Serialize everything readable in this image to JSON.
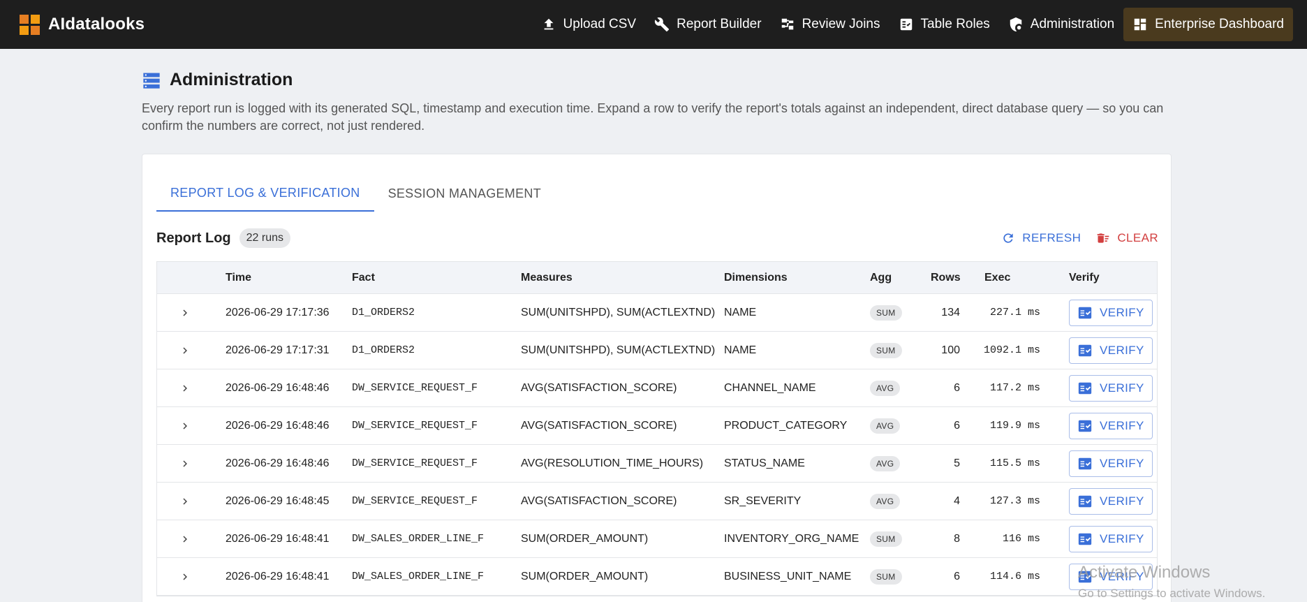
{
  "app": {
    "name": "AIdatalooks"
  },
  "nav": [
    {
      "label": "Upload CSV",
      "icon": "upload-icon"
    },
    {
      "label": "Report Builder",
      "icon": "wrench-icon"
    },
    {
      "label": "Review Joins",
      "icon": "joins-icon"
    },
    {
      "label": "Table Roles",
      "icon": "checklist-icon"
    },
    {
      "label": "Administration",
      "icon": "admin-shield-icon"
    },
    {
      "label": "Enterprise Dashboard",
      "icon": "dashboard-icon",
      "active": true
    }
  ],
  "page": {
    "title": "Administration",
    "description": "Every report run is logged with its generated SQL, timestamp and execution time. Expand a row to verify the report's totals against an independent, direct database query — so you can confirm the numbers are correct, not just rendered."
  },
  "tabs": [
    {
      "label": "REPORT LOG & VERIFICATION",
      "active": true
    },
    {
      "label": "SESSION MANAGEMENT",
      "active": false
    }
  ],
  "report_log": {
    "title": "Report Log",
    "runs_badge": "22 runs",
    "refresh_label": "REFRESH",
    "clear_label": "CLEAR",
    "columns": {
      "time": "Time",
      "fact": "Fact",
      "measures": "Measures",
      "dimensions": "Dimensions",
      "agg": "Agg",
      "rows": "Rows",
      "exec": "Exec",
      "verify": "Verify"
    },
    "verify_label": "VERIFY",
    "rows": [
      {
        "time": "2026-06-29 17:17:36",
        "fact": "D1_ORDERS2",
        "measures": "SUM(UNITSHPD), SUM(ACTLEXTND)",
        "dimensions": "NAME",
        "agg": "SUM",
        "rows": "134",
        "exec": "227.1 ms"
      },
      {
        "time": "2026-06-29 17:17:31",
        "fact": "D1_ORDERS2",
        "measures": "SUM(UNITSHPD), SUM(ACTLEXTND)",
        "dimensions": "NAME",
        "agg": "SUM",
        "rows": "100",
        "exec": "1092.1 ms"
      },
      {
        "time": "2026-06-29 16:48:46",
        "fact": "DW_SERVICE_REQUEST_F",
        "measures": "AVG(SATISFACTION_SCORE)",
        "dimensions": "CHANNEL_NAME",
        "agg": "AVG",
        "rows": "6",
        "exec": "117.2 ms"
      },
      {
        "time": "2026-06-29 16:48:46",
        "fact": "DW_SERVICE_REQUEST_F",
        "measures": "AVG(SATISFACTION_SCORE)",
        "dimensions": "PRODUCT_CATEGORY",
        "agg": "AVG",
        "rows": "6",
        "exec": "119.9 ms"
      },
      {
        "time": "2026-06-29 16:48:46",
        "fact": "DW_SERVICE_REQUEST_F",
        "measures": "AVG(RESOLUTION_TIME_HOURS)",
        "dimensions": "STATUS_NAME",
        "agg": "AVG",
        "rows": "5",
        "exec": "115.5 ms"
      },
      {
        "time": "2026-06-29 16:48:45",
        "fact": "DW_SERVICE_REQUEST_F",
        "measures": "AVG(SATISFACTION_SCORE)",
        "dimensions": "SR_SEVERITY",
        "agg": "AVG",
        "rows": "4",
        "exec": "127.3 ms"
      },
      {
        "time": "2026-06-29 16:48:41",
        "fact": "DW_SALES_ORDER_LINE_F",
        "measures": "SUM(ORDER_AMOUNT)",
        "dimensions": "INVENTORY_ORG_NAME",
        "agg": "SUM",
        "rows": "8",
        "exec": "116 ms"
      },
      {
        "time": "2026-06-29 16:48:41",
        "fact": "DW_SALES_ORDER_LINE_F",
        "measures": "SUM(ORDER_AMOUNT)",
        "dimensions": "BUSINESS_UNIT_NAME",
        "agg": "SUM",
        "rows": "6",
        "exec": "114.6 ms"
      }
    ]
  },
  "watermark": {
    "line1": "Activate Windows",
    "line2": "Go to Settings to activate Windows."
  }
}
